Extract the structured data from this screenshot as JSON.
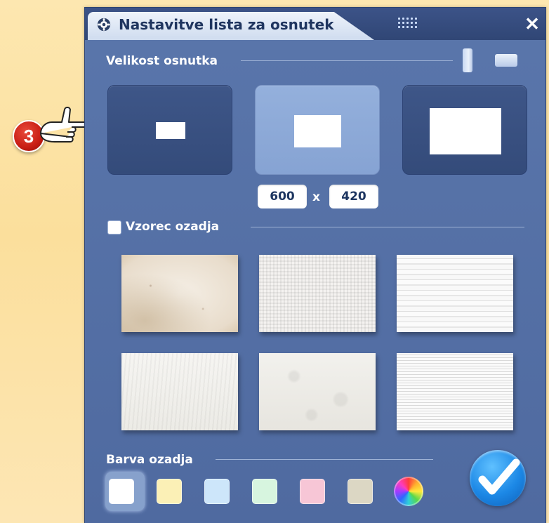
{
  "step_marker": "3",
  "window": {
    "title": "Nastavitve lista za osnutek",
    "close_label": "✕"
  },
  "size_section": {
    "label": "Velikost osnutka",
    "options": [
      "small",
      "medium",
      "large"
    ],
    "selected": "medium",
    "width": "600",
    "height": "420",
    "separator": "x"
  },
  "pattern_section": {
    "label": "Vzorec ozadja",
    "checked": false,
    "textures": [
      "aged-paper",
      "canvas-weave",
      "horizontal-stripes",
      "fibrous-paper",
      "crumpled-paper",
      "fine-lines"
    ]
  },
  "color_section": {
    "label": "Barva ozadja",
    "swatches": [
      "#ffffff",
      "#fbf0b6",
      "#cde6fa",
      "#d7f5df",
      "#f7c6d6",
      "#dcd7c4"
    ],
    "selected": "#ffffff"
  },
  "colors": {
    "dialog_bg": "#5a76ab",
    "title_tab": "#dfe8f5",
    "accent": "#1c88e6"
  }
}
